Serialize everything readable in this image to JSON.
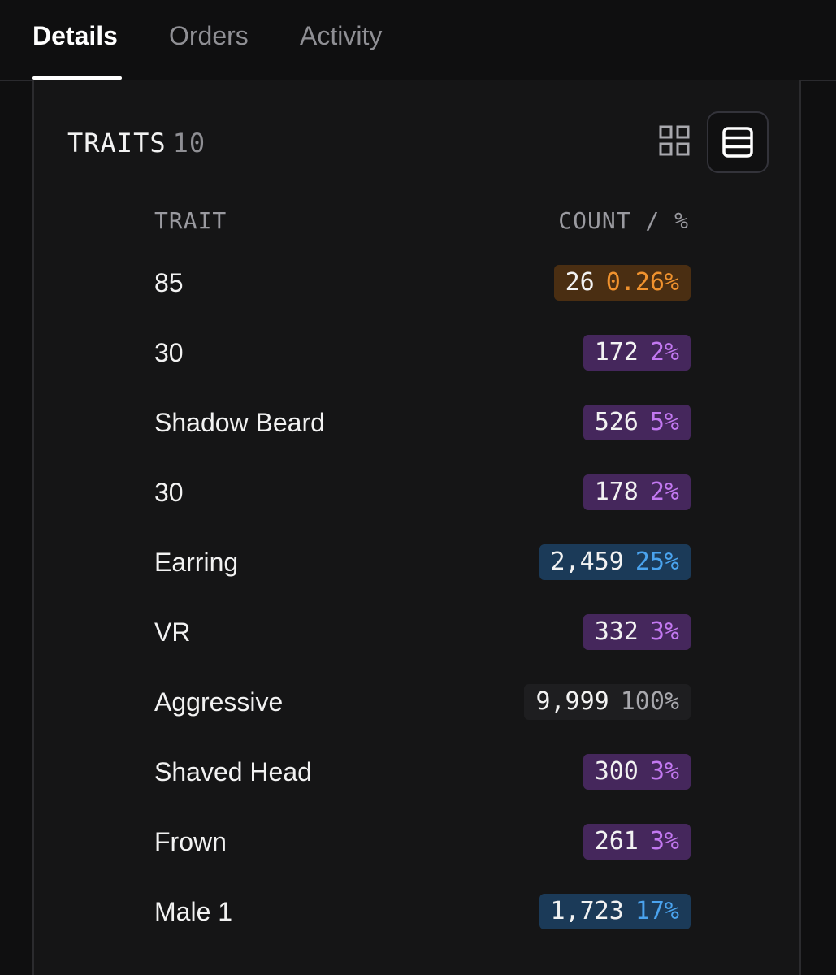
{
  "tabs": [
    {
      "label": "Details",
      "active": true
    },
    {
      "label": "Orders",
      "active": false
    },
    {
      "label": "Activity",
      "active": false
    }
  ],
  "traits": {
    "title": "TRAITS",
    "count": "10",
    "column_trait": "TRAIT",
    "column_count": "COUNT / %",
    "view_icons": [
      "grid-view-icon",
      "list-view-icon"
    ],
    "rows": [
      {
        "name": "85",
        "count": "26",
        "percent": "0.26%",
        "tier": "orange"
      },
      {
        "name": "30",
        "count": "172",
        "percent": "2%",
        "tier": "purple"
      },
      {
        "name": "Shadow Beard",
        "count": "526",
        "percent": "5%",
        "tier": "purple"
      },
      {
        "name": "30",
        "count": "178",
        "percent": "2%",
        "tier": "purple"
      },
      {
        "name": "Earring",
        "count": "2,459",
        "percent": "25%",
        "tier": "blue"
      },
      {
        "name": "VR",
        "count": "332",
        "percent": "3%",
        "tier": "purple"
      },
      {
        "name": "Aggressive",
        "count": "9,999",
        "percent": "100%",
        "tier": "gray"
      },
      {
        "name": "Shaved Head",
        "count": "300",
        "percent": "3%",
        "tier": "purple"
      },
      {
        "name": "Frown",
        "count": "261",
        "percent": "3%",
        "tier": "purple"
      },
      {
        "name": "Male 1",
        "count": "1,723",
        "percent": "17%",
        "tier": "blue"
      }
    ]
  },
  "colors": {
    "orange": {
      "bg": "#4a2e12",
      "pct": "#f0922e"
    },
    "purple": {
      "bg": "#45275c",
      "pct": "#c278f0"
    },
    "blue": {
      "bg": "#1b3a58",
      "pct": "#4aa3ee"
    },
    "gray": {
      "bg": "#1e1e20",
      "pct": "#a8a8ad"
    }
  }
}
